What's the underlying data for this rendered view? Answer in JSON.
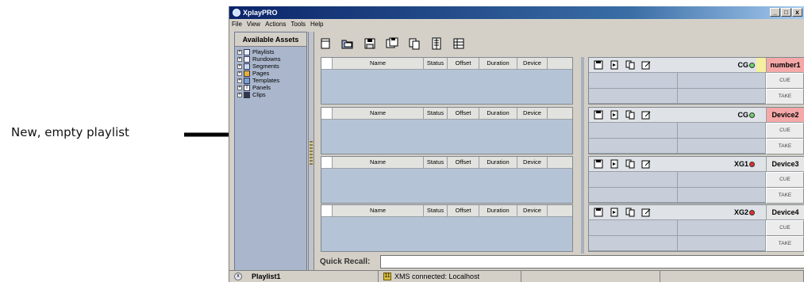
{
  "annotation": {
    "label": "New, empty playlist"
  },
  "window": {
    "title": "XplayPRO",
    "controls": [
      "_",
      "□",
      "x"
    ]
  },
  "menu": [
    "File",
    "View",
    "Actions",
    "Tools",
    "Help"
  ],
  "assets": {
    "title": "Available Assets",
    "items": [
      {
        "label": "Playlists",
        "icon": "playlist-icon"
      },
      {
        "label": "Rundowns",
        "icon": "rundown-icon"
      },
      {
        "label": "Segments",
        "icon": "segment-icon"
      },
      {
        "label": "Pages",
        "icon": "page-icon"
      },
      {
        "label": "Templates",
        "icon": "template-icon"
      },
      {
        "label": "Panels",
        "icon": "panel-icon"
      },
      {
        "label": "Clips",
        "icon": "clip-icon"
      }
    ]
  },
  "toolbar": {
    "buttons": [
      "new-playlist",
      "open",
      "save",
      "save-all",
      "copy",
      "properties",
      "rundown"
    ]
  },
  "playlist_columns": [
    "Name",
    "Status",
    "Offset",
    "Duration",
    "Device"
  ],
  "devices": [
    {
      "code": "CG",
      "led": "green",
      "name": "number1",
      "highlight": true
    },
    {
      "code": "CG",
      "led": "green",
      "name": "Device2",
      "highlight": false
    },
    {
      "code": "XG1",
      "led": "red",
      "name": "Device3",
      "highlight": false
    },
    {
      "code": "XG2",
      "led": "red",
      "name": "Device4",
      "highlight": false
    }
  ],
  "device_buttons": {
    "cue": "CUE",
    "take": "TAKE"
  },
  "quick_recall": {
    "label": "Quick Recall:",
    "value": ""
  },
  "statusbar": {
    "playlist": "Playlist1",
    "connection": "XMS connected: Localhost"
  }
}
